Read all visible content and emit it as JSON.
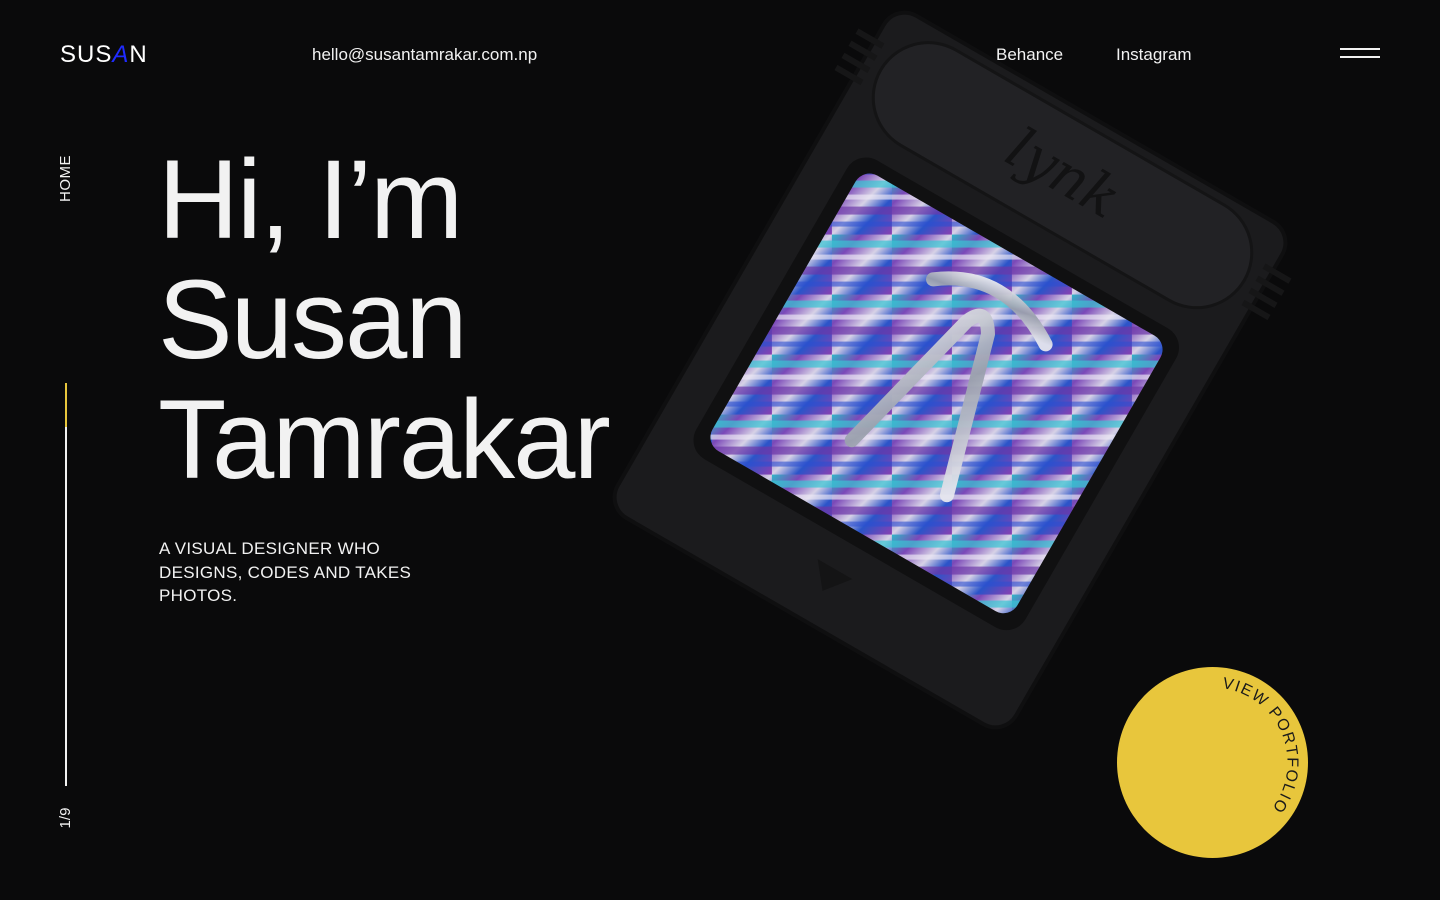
{
  "header": {
    "logo_parts": [
      "SUS",
      "A",
      "N"
    ],
    "email": "hello@susantamrakar.com.np",
    "nav": [
      {
        "label": "Behance"
      },
      {
        "label": "Instagram"
      }
    ]
  },
  "side": {
    "section": "HOME",
    "counter": "1/9"
  },
  "hero": {
    "line1": "Hi, I’m",
    "line2": "Susan",
    "line3": "Tamrakar",
    "subtitle": "A VISUAL DESIGNER WHO DESIGNS, CODES AND TAKES PHOTOS."
  },
  "artwork": {
    "cartridge_label": "lynk"
  },
  "cta": {
    "label": "VIEW PORTFOLIO"
  },
  "colors": {
    "background": "#0a0a0b",
    "accent_yellow": "#e8c63c",
    "logo_accent": "#1f2bff",
    "text": "#f2f2f2"
  }
}
